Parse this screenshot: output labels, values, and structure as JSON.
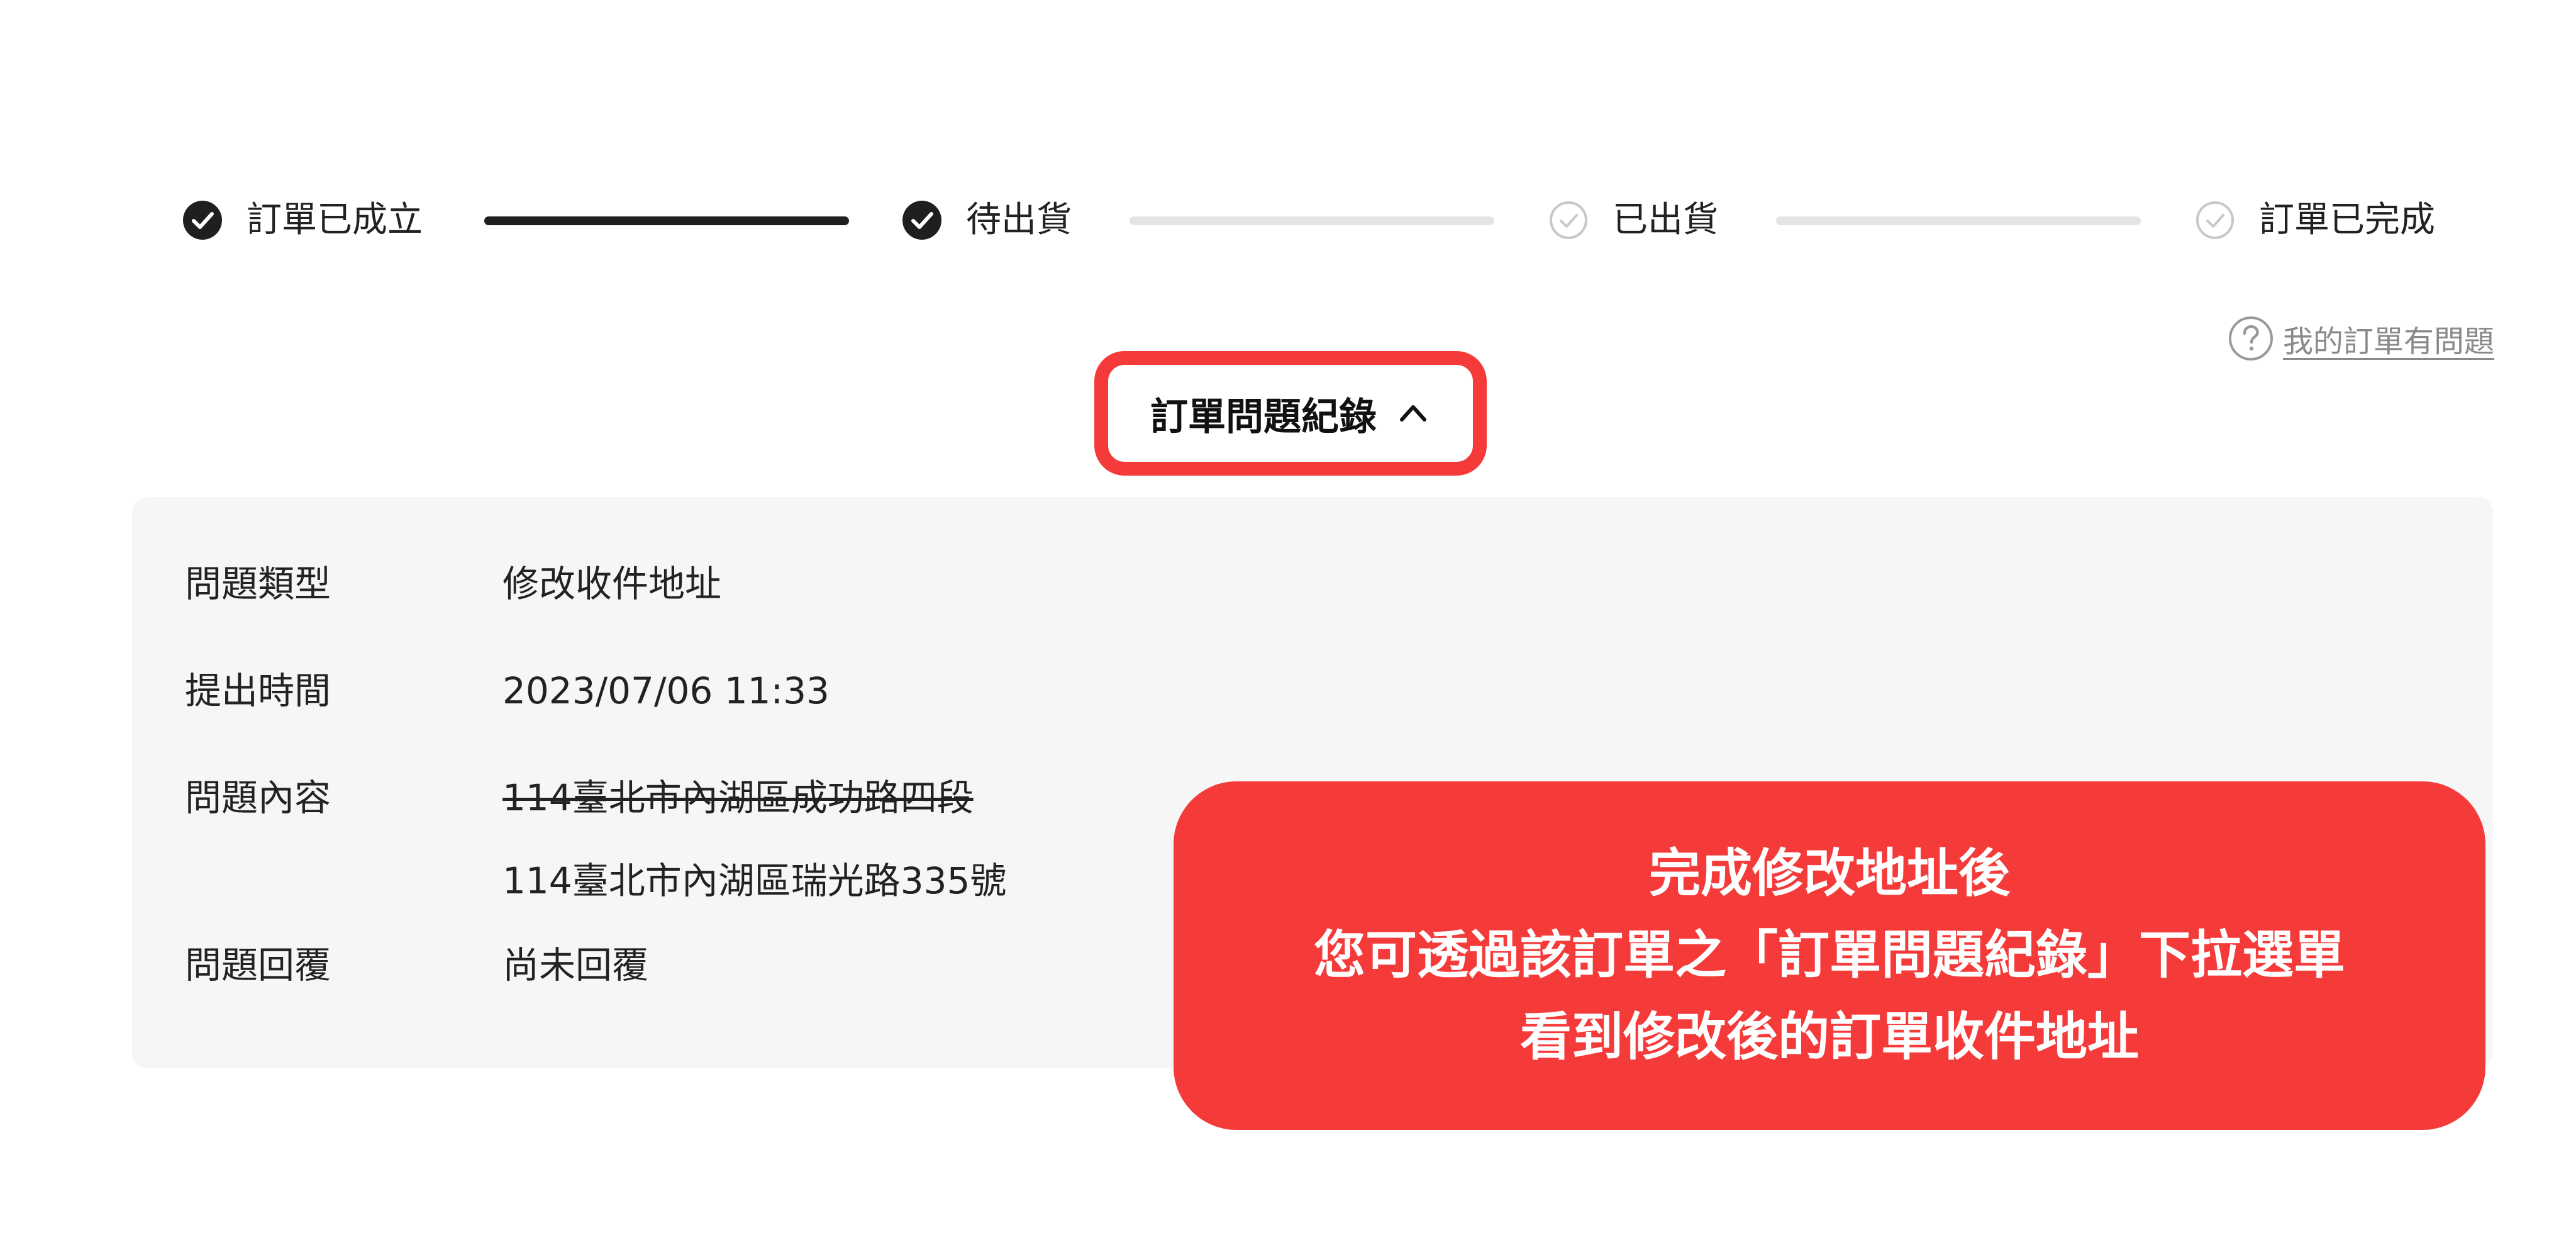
{
  "stepper": {
    "steps": [
      {
        "label": "訂單已成立",
        "status": "completed"
      },
      {
        "label": "待出貨",
        "status": "completed"
      },
      {
        "label": "已出貨",
        "status": "pending"
      },
      {
        "label": "訂單已完成",
        "status": "pending"
      }
    ]
  },
  "help_link": {
    "label": "我的訂單有問題",
    "icon": "question-circle-icon"
  },
  "record_toggle": {
    "label": "訂單問題紀錄",
    "icon": "chevron-up-icon",
    "expanded": true
  },
  "details": {
    "issue_type": {
      "label": "問題類型",
      "value": "修改收件地址"
    },
    "submitted_time": {
      "label": "提出時間",
      "value": "2023/07/06 11:33"
    },
    "issue_content": {
      "label": "問題內容",
      "old_value": "114臺北市內湖區成功路四段",
      "new_value": "114臺北市內湖區瑞光路335號"
    },
    "reply": {
      "label": "問題回覆",
      "value": "尚未回覆"
    }
  },
  "callout": {
    "lines": [
      "完成修改地址後",
      "您可透過該訂單之「訂單問題紀錄」下拉選單",
      "看到修改後的訂單收件地址"
    ]
  },
  "colors": {
    "highlight_red": "#f53a3a",
    "step_done": "#1f1f1f",
    "step_todo": "#e4e4e4",
    "panel_bg": "#f6f6f6",
    "muted_text": "#8a8a8a"
  }
}
